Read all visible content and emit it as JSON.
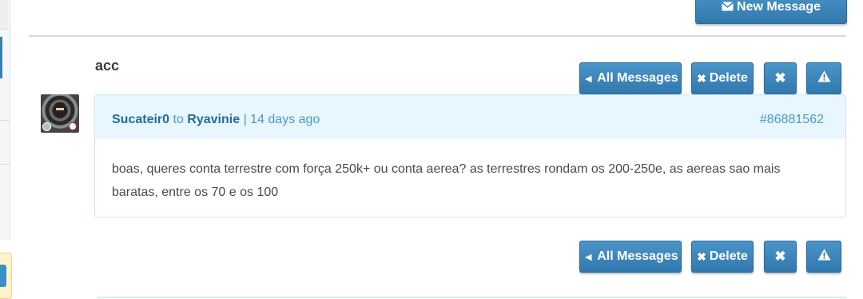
{
  "header": {
    "new_message_label": "New Message",
    "new_message_icon": "envelope-icon"
  },
  "message": {
    "subject": "acc",
    "sender": "Sucateir0",
    "to_word": "to",
    "recipient": "Ryavinie",
    "time": "| 14 days ago",
    "id": "#86881562",
    "body": "boas, queres conta terrestre com força 250k+ ou conta aerea? as terrestres rondam os 200-250e, as aereas sao mais baratas, entre os 70 e os 100"
  },
  "actions": {
    "all_messages_label": "All Messages",
    "all_messages_icon": "arrow-left-icon",
    "delete_label": "Delete",
    "delete_icon": "times-icon",
    "close_icon": "times-icon",
    "report_icon": "warning-icon"
  },
  "colors": {
    "button": "#3a86bd",
    "card_header": "#e8f6fd",
    "link": "#1f6d9c",
    "meta": "#4a9bc9"
  }
}
